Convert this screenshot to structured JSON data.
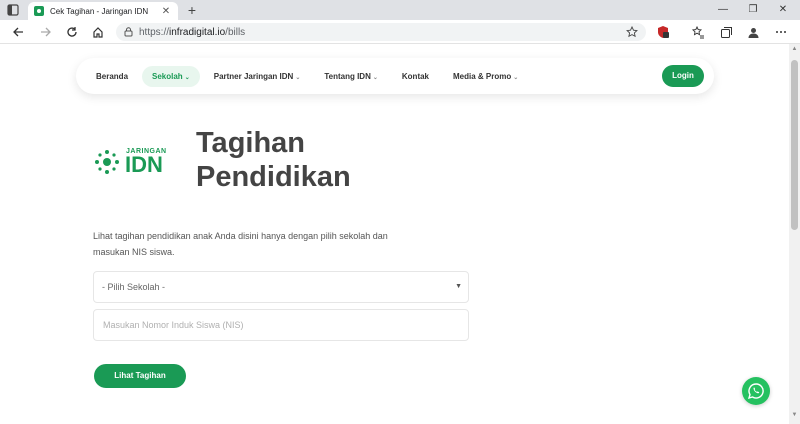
{
  "browser": {
    "tab_title": "Cek Tagihan - Jaringan IDN",
    "url_protocol": "https://",
    "url_host": "infradigital.io",
    "url_path": "/bills"
  },
  "nav": {
    "items": [
      {
        "label": "Beranda",
        "active": false,
        "dropdown": false
      },
      {
        "label": "Sekolah",
        "active": true,
        "dropdown": true
      },
      {
        "label": "Partner Jaringan IDN",
        "active": false,
        "dropdown": true
      },
      {
        "label": "Tentang IDN",
        "active": false,
        "dropdown": true
      },
      {
        "label": "Kontak",
        "active": false,
        "dropdown": false
      },
      {
        "label": "Media & Promo",
        "active": false,
        "dropdown": true
      }
    ],
    "login_label": "Login"
  },
  "logo": {
    "line1": "JARINGAN",
    "line2": "IDN"
  },
  "heading": {
    "line1": "Tagihan",
    "line2": "Pendidikan"
  },
  "description": "Lihat tagihan pendidikan anak Anda disini hanya dengan pilih sekolah dan masukan NIS siswa.",
  "form": {
    "school_select_value": "- Pilih Sekolah -",
    "nis_placeholder": "Masukan Nomor Induk Siswa (NIS)",
    "submit_label": "Lihat Tagihan"
  },
  "colors": {
    "brand": "#1a9a55",
    "whatsapp": "#25c160"
  },
  "icons": [
    "whatsapp-icon",
    "chevron-down-icon",
    "lock-icon",
    "star-icon"
  ]
}
